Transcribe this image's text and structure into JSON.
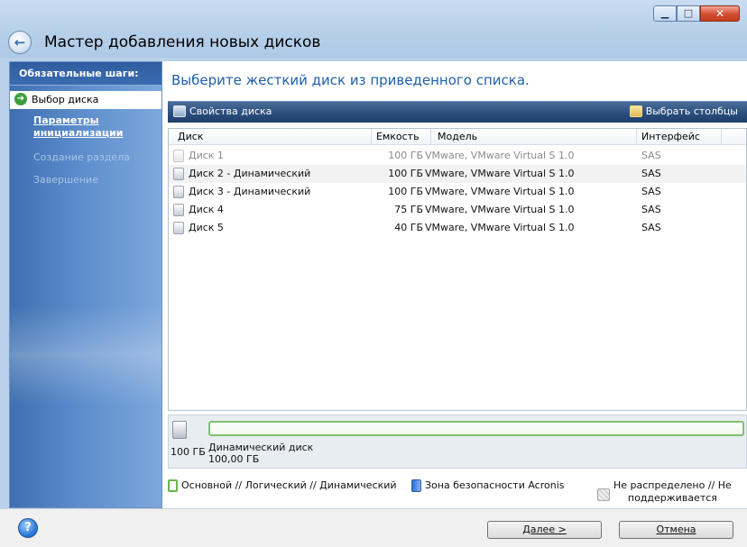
{
  "window": {
    "title": "Мастер добавления новых дисков",
    "controls": {
      "minimize": "▁",
      "maximize": "□",
      "close": "✕"
    }
  },
  "sidebar": {
    "heading": "Обязательные шаги:",
    "items": [
      {
        "label": "Выбор диска",
        "state": "active"
      },
      {
        "label": "Параметры инициализации",
        "state": "link"
      },
      {
        "label": "Создание раздела",
        "state": "disabled"
      },
      {
        "label": "Завершение",
        "state": "disabled"
      }
    ]
  },
  "main": {
    "instruction": "Выберите жесткий диск из приведенного списка.",
    "toolbar": {
      "properties_label": "Свойства диска",
      "columns_label": "Выбрать столбцы"
    },
    "table": {
      "columns": [
        "Диск",
        "Емкость",
        "Модель",
        "Интерфейс"
      ],
      "rows": [
        {
          "disk": "Диск 1",
          "capacity": "100 ГБ",
          "model": "VMware, VMware Virtual S 1.0",
          "interface": "SAS",
          "enabled": false
        },
        {
          "disk": "Диск 2 - Динамический",
          "capacity": "100 ГБ",
          "model": "VMware, VMware Virtual S 1.0",
          "interface": "SAS",
          "enabled": true,
          "selected": true
        },
        {
          "disk": "Диск 3 - Динамический",
          "capacity": "100 ГБ",
          "model": "VMware, VMware Virtual S 1.0",
          "interface": "SAS",
          "enabled": true
        },
        {
          "disk": "Диск 4",
          "capacity": "75 ГБ",
          "model": "VMware, VMware Virtual S 1.0",
          "interface": "SAS",
          "enabled": true
        },
        {
          "disk": "Диск 5",
          "capacity": "40 ГБ",
          "model": "VMware, VMware Virtual S 1.0",
          "interface": "SAS",
          "enabled": true
        }
      ]
    },
    "disk_summary": {
      "size": "100 ГБ",
      "type": "Динамический диск",
      "partition_size": "100,00 ГБ"
    },
    "legend": {
      "primary": "Основной // Логический // Динамический",
      "acronis": "Зона безопасности Acronis",
      "unallocated_line1": "Не распределено // Не",
      "unallocated_line2": "поддерживается"
    }
  },
  "footer": {
    "help": "?",
    "next_label": "Далее >",
    "cancel_label": "Отмена"
  },
  "colors": {
    "accent_text": "#1f5fa8",
    "toolbar": "#2b4e7c",
    "sidebar": "#5c8ccc",
    "primary_partition": "#69b54f",
    "acronis_zone": "#2f6fd0"
  }
}
